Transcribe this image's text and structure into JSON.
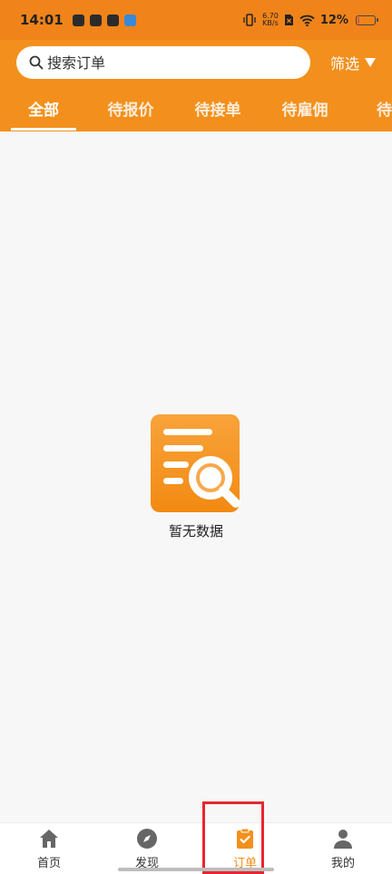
{
  "status_bar": {
    "time": "14:01",
    "net_speed_value": "6.70",
    "net_speed_unit": "KB/s",
    "battery_percent": "12%",
    "battery_level": 0.12
  },
  "search": {
    "placeholder": "搜索订单",
    "filter_label": "筛选"
  },
  "tabs": [
    {
      "label": "全部",
      "active": true
    },
    {
      "label": "待报价",
      "active": false
    },
    {
      "label": "待接单",
      "active": false
    },
    {
      "label": "待雇佣",
      "active": false
    },
    {
      "label": "待付",
      "active": false
    }
  ],
  "empty_state": {
    "text": "暂无数据"
  },
  "bottom_nav": [
    {
      "label": "首页",
      "icon": "home-icon",
      "active": false
    },
    {
      "label": "发现",
      "icon": "compass-icon",
      "active": false
    },
    {
      "label": "订单",
      "icon": "order-icon",
      "active": true
    },
    {
      "label": "我的",
      "icon": "user-icon",
      "active": false
    }
  ],
  "colors": {
    "brand": "#f3901d",
    "status_bar": "#f0841a",
    "highlight": "#e8262e"
  }
}
